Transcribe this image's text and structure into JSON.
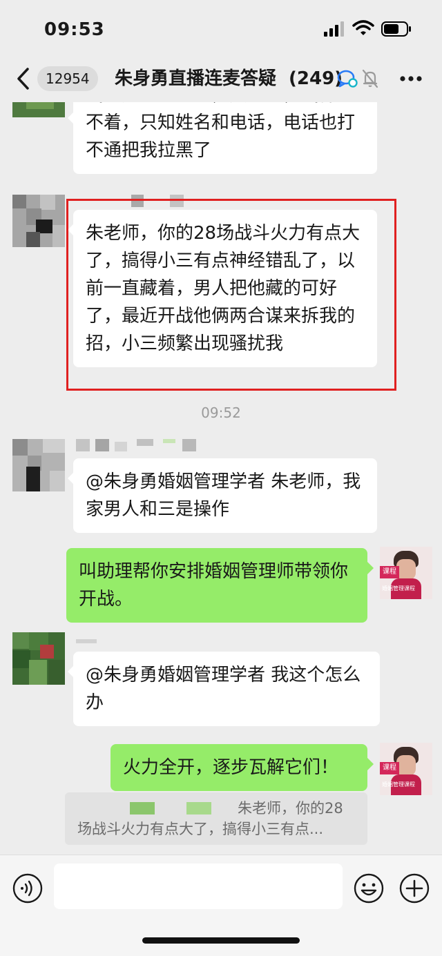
{
  "status_bar": {
    "time": "09:53"
  },
  "header": {
    "unread_count": "12954",
    "title": "朱身勇直播连麦答疑",
    "member_count": "(249)"
  },
  "messages": [
    {
      "side": "left",
      "text": "我这边这个小三，失踪了，我都找不着，只知姓名和电话，电话也打不通把我拉黑了"
    },
    {
      "side": "left",
      "text": "朱老师，你的28场战斗火力有点大了，搞得小三有点神经错乱了，以前一直藏着，男人把他藏的可好了，最近开战他俩两合谋来拆我的招，小三频繁出现骚扰我"
    },
    {
      "type": "time",
      "text": "09:52"
    },
    {
      "side": "left",
      "text": "@朱身勇婚姻管理学者 朱老师，我家男人和三是操作"
    },
    {
      "side": "right",
      "text": "叫助理帮你安排婚姻管理师带领你开战。"
    },
    {
      "side": "left",
      "text": "@朱身勇婚姻管理学者 我这个怎么办"
    },
    {
      "side": "right",
      "text": "火力全开，逐步瓦解它们！"
    }
  ],
  "quote": {
    "line1": "朱老师，你的28",
    "line2": "场战斗火力有点大了，搞得小三有点..."
  },
  "avatar_right": {
    "label_top": "课程",
    "label_bottom": "婚姻管理课程"
  },
  "colors": {
    "background": "#ededed",
    "bubble_self": "#95ec69",
    "bubble_other": "#ffffff",
    "highlight": "#e02020"
  },
  "icons": [
    "back-icon",
    "signal-icon",
    "wifi-icon",
    "battery-icon",
    "channel-icon",
    "mute-icon",
    "more-icon",
    "voice-icon",
    "emoji-icon",
    "plus-icon"
  ]
}
